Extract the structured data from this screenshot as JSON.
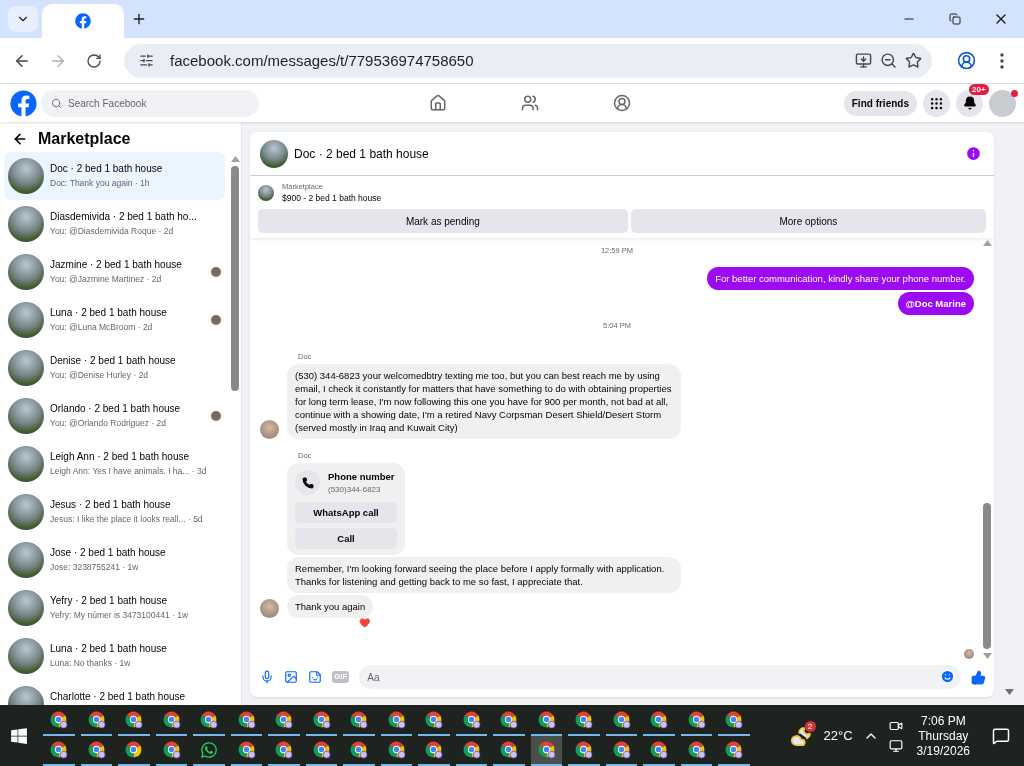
{
  "browser": {
    "url": "facebook.com/messages/t/779536974758650"
  },
  "header": {
    "search_placeholder": "Search Facebook",
    "find_friends": "Find friends",
    "notification_badge": "20+"
  },
  "sidebar": {
    "title": "Marketplace",
    "conversations": [
      {
        "name": "Doc · 2 bed 1 bath house",
        "preview": "Doc: Thank you again · 1h",
        "selected": true,
        "seen_avatar": false
      },
      {
        "name": "Diasdemivida · 2 bed 1 bath ho...",
        "preview": "You: @Diasdemivida Roque · 2d",
        "selected": false,
        "seen_avatar": false
      },
      {
        "name": "Jazmine · 2 bed 1 bath house",
        "preview": "You: @Jazmine Martinez · 2d",
        "selected": false,
        "seen_avatar": true
      },
      {
        "name": "Luna · 2 bed 1 bath house",
        "preview": "You: @Luna McBroom · 2d",
        "selected": false,
        "seen_avatar": true
      },
      {
        "name": "Denise · 2 bed 1 bath house",
        "preview": "You: @Denise Hurley · 2d",
        "selected": false,
        "seen_avatar": false
      },
      {
        "name": "Orlando · 2 bed 1 bath house",
        "preview": "You: @Orlando Rodriguez · 2d",
        "selected": false,
        "seen_avatar": true
      },
      {
        "name": "Leigh Ann · 2 bed 1 bath house",
        "preview": "Leigh Ann: Yes I have animals. I ha... · 3d",
        "selected": false,
        "seen_avatar": false
      },
      {
        "name": "Jesus · 2 bed 1 bath house",
        "preview": "Jesus: I like the place it looks reall... · 5d",
        "selected": false,
        "seen_avatar": false
      },
      {
        "name": "Jose · 2 bed 1 bath house",
        "preview": "Jose: 3238755241 · 1w",
        "selected": false,
        "seen_avatar": false
      },
      {
        "name": "Yefry · 2 bed 1 bath house",
        "preview": "Yefry: My númer is 3473100441 · 1w",
        "selected": false,
        "seen_avatar": false
      },
      {
        "name": "Luna · 2 bed 1 bath house",
        "preview": "Luna: No thanks · 1w",
        "selected": false,
        "seen_avatar": false
      },
      {
        "name": "Charlotte · 2 bed 1 bath house",
        "selected": false,
        "seen_avatar": false
      }
    ]
  },
  "chat": {
    "title": "Doc · 2 bed 1 bath house",
    "listing": {
      "label": "Marketplace",
      "title": "$900 - 2 bed 1 bath house"
    },
    "actions": [
      "Mark as pending",
      "More options"
    ],
    "messages": [
      {
        "kind": "time",
        "text": "12:59 PM"
      },
      {
        "kind": "outgoing",
        "text": "For better communication, kindly share your phone number.",
        "mention": false
      },
      {
        "kind": "outgoing",
        "text": "@Doc Marine",
        "mention": true
      },
      {
        "kind": "time",
        "text": "5:04 PM"
      },
      {
        "kind": "sender",
        "text": "Doc"
      },
      {
        "kind": "incoming",
        "text": "(530) 344-6823 your welcomedbtry texting me too, but you can best reach me by using email, I check it constantly for matters that have something to do with obtaining properties for long term lease, I'm now following this one you have for 900 per month, not bad at all, continue with a showing date, I'm a retired Navy Corpsman Desert Shield/Desert Storm (served mostly in Iraq and Kuwait City)",
        "avatar": true
      },
      {
        "kind": "sender",
        "text": "Doc"
      },
      {
        "kind": "contact",
        "title": "Phone number",
        "number": "(530)344-6823",
        "buttons": [
          "WhatsApp call",
          "Call"
        ]
      },
      {
        "kind": "incoming",
        "text": "Remember, I'm looking forward seeing the place before I apply formally with application. Thanks for listening and getting back to me so fast, I appreciate that.",
        "avatar": false
      },
      {
        "kind": "incoming",
        "text": "Thank you again",
        "avatar": true,
        "reaction": "❤️"
      }
    ],
    "seen_avatar": true,
    "gif_label": "GIF",
    "composer_placeholder": "Aa"
  },
  "taskbar": {
    "apps": [
      [
        {
          "kind": "chrome-profile",
          "selected": false
        },
        {
          "kind": "chrome-profile",
          "selected": false
        },
        {
          "kind": "chrome-profile",
          "selected": false
        },
        {
          "kind": "chrome-profile",
          "selected": false
        },
        {
          "kind": "chrome-profile",
          "selected": false
        },
        {
          "kind": "chrome-profile",
          "selected": false
        },
        {
          "kind": "chrome-profile",
          "selected": false
        },
        {
          "kind": "chrome-profile",
          "selected": false
        },
        {
          "kind": "chrome-profile",
          "selected": false
        },
        {
          "kind": "chrome-profile",
          "selected": false
        },
        {
          "kind": "chrome-profile",
          "selected": false
        },
        {
          "kind": "chrome-profile",
          "selected": false
        },
        {
          "kind": "chrome-profile",
          "selected": false
        },
        {
          "kind": "chrome-profile",
          "selected": false
        },
        {
          "kind": "chrome-profile",
          "selected": false
        },
        {
          "kind": "chrome-profile",
          "selected": false
        },
        {
          "kind": "chrome-profile",
          "selected": false
        },
        {
          "kind": "chrome-profile",
          "selected": false
        },
        {
          "kind": "chrome-profile",
          "selected": false
        }
      ],
      [
        {
          "kind": "chrome-profile",
          "selected": false
        },
        {
          "kind": "chrome-profile",
          "selected": false
        },
        {
          "kind": "chrome",
          "selected": false
        },
        {
          "kind": "chrome-profile",
          "selected": false
        },
        {
          "kind": "whatsapp",
          "selected": false
        },
        {
          "kind": "chrome-profile",
          "selected": false
        },
        {
          "kind": "chrome-profile",
          "selected": false
        },
        {
          "kind": "chrome-profile",
          "selected": false
        },
        {
          "kind": "chrome-profile",
          "selected": false
        },
        {
          "kind": "chrome-profile",
          "selected": false
        },
        {
          "kind": "chrome-profile",
          "selected": false
        },
        {
          "kind": "chrome-profile",
          "selected": false
        },
        {
          "kind": "chrome-profile",
          "selected": false
        },
        {
          "kind": "chrome-profile",
          "selected": true
        },
        {
          "kind": "chrome-profile",
          "selected": false
        },
        {
          "kind": "chrome-profile",
          "selected": false
        },
        {
          "kind": "chrome-profile",
          "selected": false
        },
        {
          "kind": "chrome-profile",
          "selected": false
        },
        {
          "kind": "chrome-profile",
          "selected": false
        }
      ]
    ],
    "weather_badge": "2",
    "temperature": "22°C",
    "time": "7:06 PM",
    "day": "Thursday",
    "date": "3/19/2026"
  }
}
